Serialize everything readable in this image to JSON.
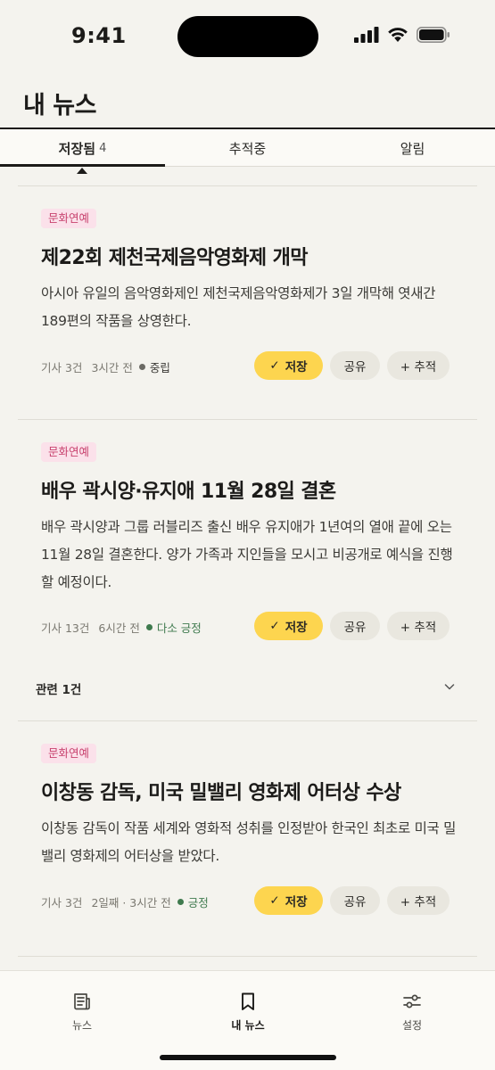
{
  "status_bar": {
    "time": "9:41"
  },
  "header": {
    "title": "내 뉴스"
  },
  "tabs": [
    {
      "label": "저장됨",
      "count": "4",
      "active": true
    },
    {
      "label": "추적중",
      "active": false
    },
    {
      "label": "알림",
      "active": false
    }
  ],
  "articles": [
    {
      "category": "문화연예",
      "title": "제22회 제천국제음악영화제 개막",
      "summary": "아시아 유일의 음악영화제인 제천국제음악영화제가 3일 개막해 엿새간 189편의 작품을 상영한다.",
      "article_count": "기사 3건",
      "time": "3시간 전",
      "sentiment": "중립",
      "sentiment_color": "#6b6a64"
    },
    {
      "category": "문화연예",
      "title": "배우 곽시양·유지애 11월 28일 결혼",
      "summary": "배우 곽시양과 그룹 러블리즈 출신 배우 유지애가 1년여의 열애 끝에 오는 11월 28일 결혼한다. 양가 가족과 지인들을 모시고 비공개로 예식을 진행할 예정이다.",
      "article_count": "기사 13건",
      "time": "6시간 전",
      "sentiment": "다소 긍정",
      "sentiment_color": "#3f7a4e"
    },
    {
      "category": "문화연예",
      "title": "이창동 감독, 미국 밀밸리 영화제 어터상 수상",
      "summary": "이창동 감독이 작품 세계와 영화적 성취를 인정받아 한국인 최초로 미국 밀밸리 영화제의 어터상을 받았다.",
      "article_count": "기사 3건",
      "time": "2일째 · 3시간 전",
      "sentiment": "긍정",
      "sentiment_color": "#3f7a4e"
    }
  ],
  "actions": {
    "save_check": "✓",
    "save": "저장",
    "share": "공유",
    "track": "+ 추적"
  },
  "related": {
    "label": "관련 1건"
  },
  "bottom_nav": [
    {
      "label": "뉴스",
      "icon": "newspaper-icon",
      "active": false
    },
    {
      "label": "내 뉴스",
      "icon": "bookmark-icon",
      "active": true
    },
    {
      "label": "설정",
      "icon": "sliders-icon",
      "active": false
    }
  ],
  "colors": {
    "accent": "#fdd54f",
    "badge_bg": "#fbe1ea",
    "badge_text": "#c8436f",
    "background": "#f4f3ee"
  }
}
